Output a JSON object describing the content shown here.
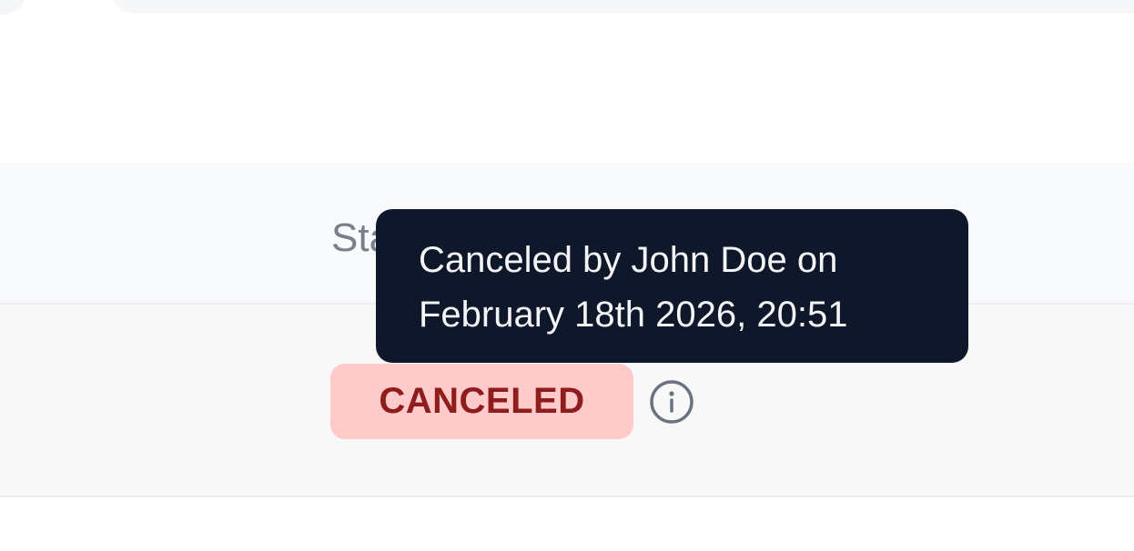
{
  "table": {
    "header": {
      "status_label": "Status"
    },
    "row": {
      "status": "CANCELED",
      "status_color": "#8f1d1d",
      "status_bg": "#fecaca",
      "info_icon": "info-circle-icon"
    }
  },
  "tooltip": {
    "line1": "Canceled by John Doe on",
    "line2": "February 18th 2026, 20:51",
    "background": "#0f172a"
  }
}
